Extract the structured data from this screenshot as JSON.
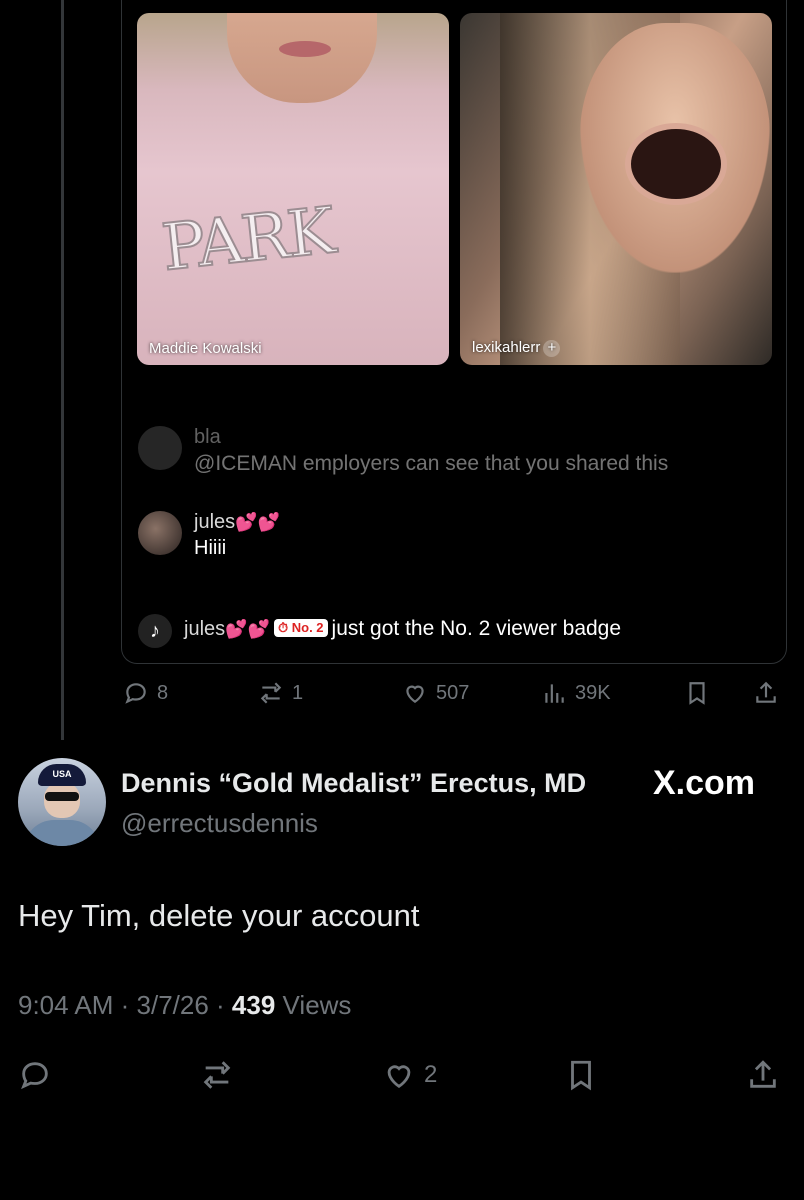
{
  "embedded_post": {
    "videos": [
      {
        "name": "Maddie Kowalski",
        "sweater_text": "PARK"
      },
      {
        "name": "lexikahlerr",
        "plus": "+"
      }
    ],
    "comments": [
      {
        "name": "bla",
        "text": "@ICEMAN employers can see that you shared this"
      },
      {
        "name": "jules",
        "hearts": "💕💕",
        "text": "Hiiii"
      },
      {
        "name": "jules",
        "hearts": "💕💕",
        "badge": "No. 2",
        "text": "just got the No. 2 viewer badge"
      }
    ],
    "actions": {
      "replies": "8",
      "reposts": "1",
      "likes": "507",
      "views": "39K"
    }
  },
  "tweet": {
    "display_name": "Dennis “Gold Medalist” Erectus, MD",
    "handle": "@errectusdennis",
    "watermark": "X.com",
    "avatar_cap_text": "USA",
    "text": "Hey Tim, delete your account",
    "time": "9:04 AM",
    "date": "3/7/26",
    "views_count": "439",
    "views_label": "Views",
    "likes": "2"
  },
  "colors": {
    "accent_gray": "#71767b",
    "text": "#e7e9ea",
    "heart_pink": "#ff4fa0"
  }
}
